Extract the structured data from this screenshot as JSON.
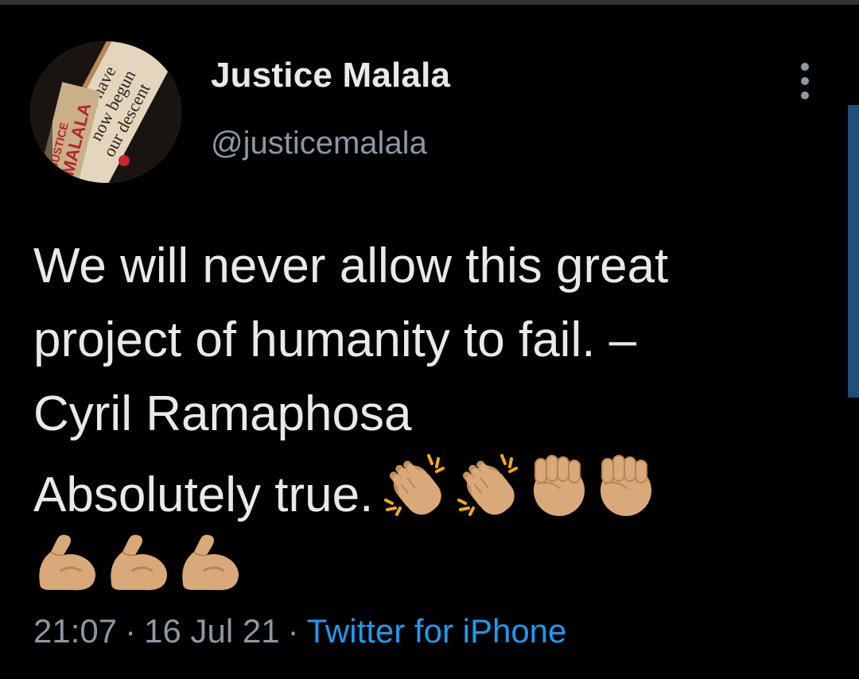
{
  "tweet": {
    "author": {
      "display_name": "Justice Malala",
      "handle": "@justicemalala",
      "avatar_book_text": [
        "We have",
        "now begun",
        "our descent"
      ],
      "avatar_author_text": [
        "JUSTICE",
        "MALALA"
      ]
    },
    "body": {
      "line1": "We will never allow this great",
      "line2": "project of humanity to fail. –",
      "line3": "Cyril Ramaphosa",
      "line4": "Absolutely true."
    },
    "emojis_line4": [
      "clapping-hands-medium-skin",
      "clapping-hands-medium-skin",
      "raised-fist-medium-skin",
      "raised-fist-medium-skin"
    ],
    "emojis_line5": [
      "flexed-biceps-medium-skin",
      "flexed-biceps-medium-skin",
      "flexed-biceps-medium-skin"
    ],
    "meta": {
      "time": "21:07",
      "date": "16 Jul 21",
      "separator": "·",
      "source": "Twitter for iPhone"
    }
  },
  "colors": {
    "background": "#000000",
    "text_primary": "#e7e9ea",
    "text_secondary": "#8b98a5",
    "link": "#1d9bf0",
    "emoji_skin": "#d9a979"
  },
  "icons": {
    "more": "more-vertical-icon"
  }
}
